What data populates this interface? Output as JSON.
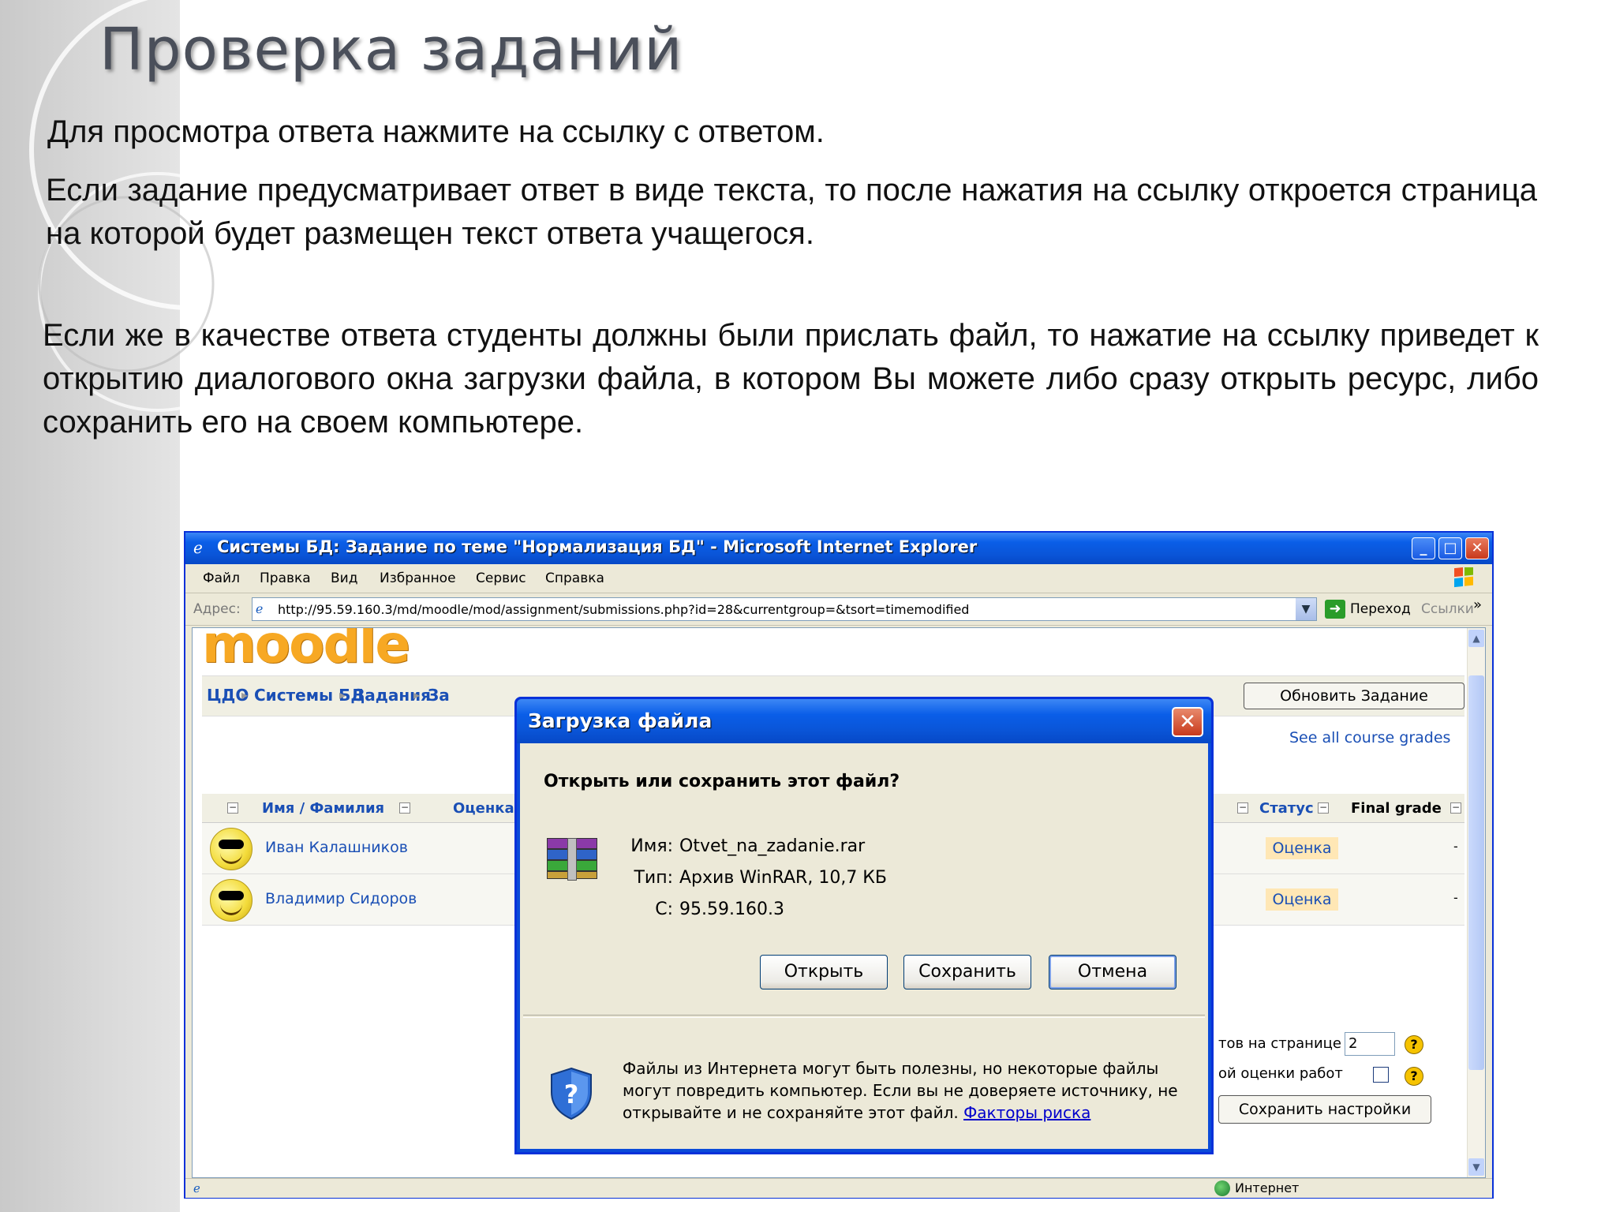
{
  "slide": {
    "title": "Проверка заданий",
    "paragraph1": "Для просмотра ответа нажмите на ссылку с ответом.",
    "paragraph2": "Если задание предусматривает ответ в виде текста, то после нажатия на ссылку откроется страница на которой будет размещен текст ответа учащегося.",
    "paragraph3": "Если же в качестве ответа студенты должны были прислать файл, то нажатие на ссылку приведет к открытию диалогового окна загрузки файла, в котором Вы можете либо сразу открыть ресурс, либо сохранить его на своем компьютере."
  },
  "window": {
    "title": "Системы БД: Задание по теме \"Нормализация БД\" - Microsoft Internet Explorer",
    "menu": [
      "Файл",
      "Правка",
      "Вид",
      "Избранное",
      "Сервис",
      "Справка"
    ],
    "address_label": "Адрес:",
    "address": "http://95.59.160.3/md/moodle/mod/assignment/submissions.php?id=28&currentgroup=&tsort=timemodified",
    "go_label": "Переход",
    "links_label": "Ссылки",
    "links_more": "»",
    "status_zone": "Интернет"
  },
  "moodle": {
    "logo": "moodle",
    "breadcrumbs": [
      "ЦДО",
      "Системы БД",
      "Задания",
      "За"
    ],
    "update_button": "Обновить Задание",
    "see_all_grades": "See all course grades",
    "table_headers": {
      "name": "Имя / Фамилия",
      "grade": "Оценка",
      "status": "Статус",
      "final_grade": "Final grade"
    },
    "rows": [
      {
        "name": "Иван Калашников",
        "status": "Оценка",
        "final": "-"
      },
      {
        "name": "Владимир Сидоров",
        "status": "Оценка",
        "final": "-"
      }
    ],
    "settings": {
      "per_page_label": "тов на странице",
      "per_page_value": "2",
      "quick_grading_label": "ой оценки работ",
      "save_button": "Сохранить настройки"
    }
  },
  "dialog": {
    "title": "Загрузка файла",
    "question": "Открыть или сохранить этот файл?",
    "name_label": "Имя:",
    "name_value": "Otvet_na_zadanie.rar",
    "type_label": "Тип:",
    "type_value": "Архив WinRAR, 10,7 КБ",
    "from_label": "С:",
    "from_value": "95.59.160.3",
    "open_button": "Открыть",
    "save_button": "Сохранить",
    "cancel_button": "Отмена",
    "warning": "Файлы из Интернета могут быть полезны, но некоторые файлы могут повредить компьютер. Если вы не доверяете источнику, не открывайте и не сохраняйте этот файл.",
    "risk_link": "Факторы риска"
  },
  "colors": {
    "xp_title_blue": "#0a55d8",
    "moodle_orange": "#f7a823",
    "link_blue": "#1a4fb5",
    "grade_badge": "#ffe7b5"
  }
}
